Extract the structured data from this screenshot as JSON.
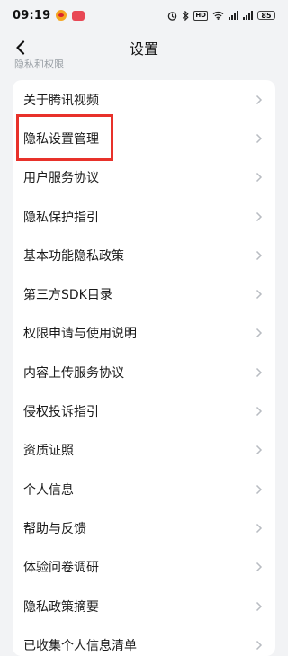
{
  "status_bar": {
    "time": "09:19",
    "battery": "85",
    "icons": [
      "weibo-icon",
      "message-icon",
      "alarm-icon",
      "bluetooth-icon",
      "hd-icon",
      "wifi-icon",
      "signal-icon",
      "signal-icon",
      "battery-icon"
    ],
    "hd_label": "HD"
  },
  "nav": {
    "title": "设置",
    "back_icon": "chevron-left-icon"
  },
  "section": {
    "header": "隐私和权限"
  },
  "menu": {
    "items": [
      {
        "label": "关于腾讯视频"
      },
      {
        "label": "隐私设置管理"
      },
      {
        "label": "用户服务协议"
      },
      {
        "label": "隐私保护指引"
      },
      {
        "label": "基本功能隐私政策"
      },
      {
        "label": "第三方SDK目录"
      },
      {
        "label": "权限申请与使用说明"
      },
      {
        "label": "内容上传服务协议"
      },
      {
        "label": "侵权投诉指引"
      },
      {
        "label": "资质证照"
      },
      {
        "label": "个人信息"
      },
      {
        "label": "帮助与反馈"
      },
      {
        "label": "体验问卷调研"
      },
      {
        "label": "隐私政策摘要"
      },
      {
        "label": "已收集个人信息清单"
      }
    ]
  },
  "highlight": {
    "target": "隐私设置管理",
    "color": "#e8312a"
  }
}
